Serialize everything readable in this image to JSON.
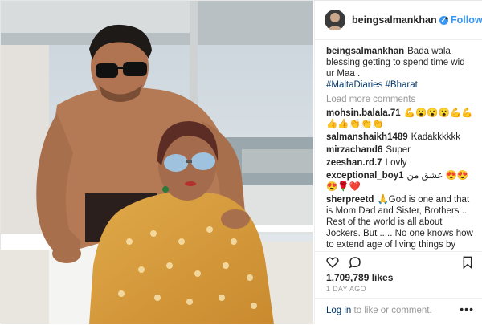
{
  "post": {
    "username": "beingsalmankhan",
    "follow_label": "Follow",
    "dot": "•",
    "caption": {
      "text": "Bada wala blessing getting to spend time wid ur Maa .",
      "tags": [
        "#MaltaDiaries",
        "#Bharat"
      ]
    },
    "load_more": "Load more comments",
    "comments": [
      {
        "user": "mohsin.balala.71",
        "text": "💪😮😮😮💪💪👍👍👏👏👏"
      },
      {
        "user": "salmanshaikh1489",
        "text": "Kadakkkkkk"
      },
      {
        "user": "mirzachand6",
        "text": "Super"
      },
      {
        "user": "zeeshan.rd.7",
        "text": "Lovly"
      },
      {
        "user": "exceptional_boy1",
        "text": "عشق من 😍😍😍🌹❤️"
      },
      {
        "user": "sherpreetd",
        "text": "🙏God is one and that is Mom Dad and Sister, Brothers .. Rest of the world is all about Jockers. But ..... No one knows how to extend age of living things by changing some parts of the body just like movies or"
      }
    ],
    "likes": "1,709,789 likes",
    "time": "1 DAY AGO",
    "login_link": "Log in",
    "login_rest": "to like or comment.",
    "more_glyph": "•••"
  },
  "icons": {
    "heart": "heart-icon",
    "comment": "comment-icon",
    "bookmark": "bookmark-icon",
    "avatar": "profile-avatar",
    "verified": "verified-badge-icon"
  },
  "colors": {
    "link": "#3897f0",
    "hashtag": "#003569",
    "muted": "#999999",
    "text": "#262626",
    "border": "#efefef"
  }
}
